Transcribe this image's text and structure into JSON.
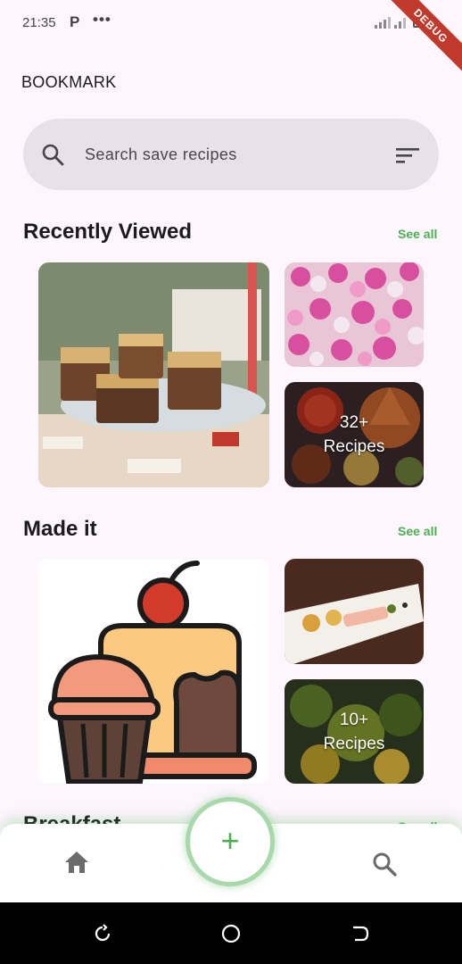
{
  "status": {
    "time": "21:35",
    "carrier_icon": "P",
    "more": "•••"
  },
  "debug_banner": "DEBUG",
  "page_title": "BOOKMARK",
  "search": {
    "placeholder": "Search save recipes"
  },
  "sections": [
    {
      "title": "Recently Viewed",
      "see_all": "See all",
      "more_count": "32+",
      "more_label": "Recipes"
    },
    {
      "title": "Made it",
      "see_all": "See all",
      "more_count": "10+",
      "more_label": "Recipes"
    },
    {
      "title": "Breakfast",
      "see_all": "See all"
    }
  ],
  "nav": {
    "add": "+"
  },
  "colors": {
    "accent": "#4caf50",
    "background": "#fdf6fd",
    "search_bg": "#e8e1ea"
  }
}
